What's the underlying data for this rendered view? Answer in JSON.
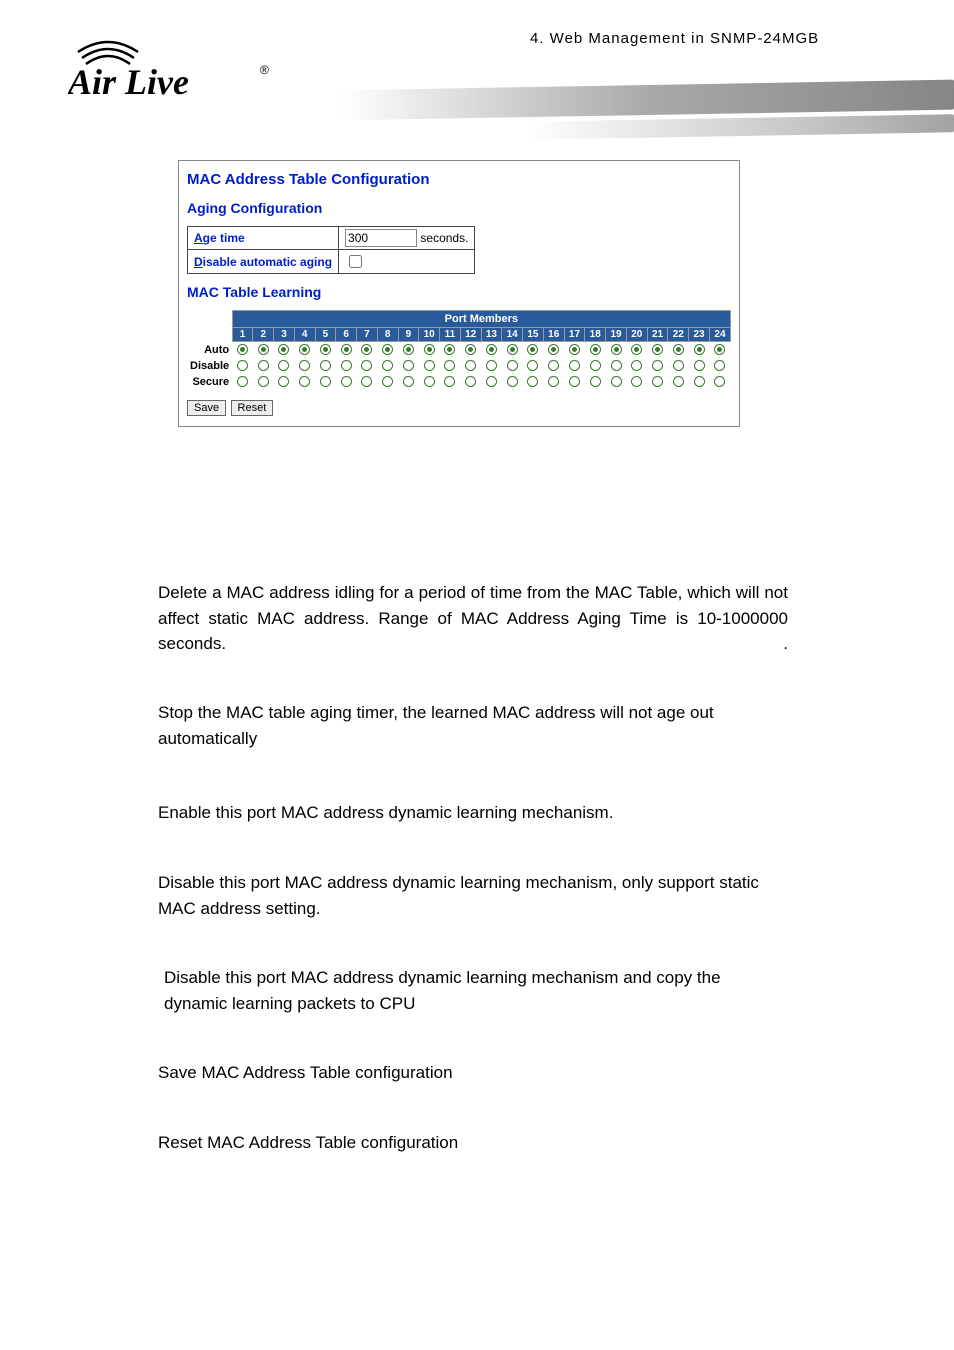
{
  "header": {
    "section": "4.  Web  Management  in  SNMP-24MGB"
  },
  "logo": {
    "brand": "Air Live",
    "mark": "®"
  },
  "panel": {
    "title": "MAC Address Table Configuration",
    "aging_title": "Aging Configuration",
    "age_time_label_u": "A",
    "age_time_label_rest": "ge time",
    "age_time_value": "300",
    "age_time_suffix": "seconds.",
    "disable_label_u": "D",
    "disable_label_rest": "isable automatic aging",
    "learning_title": "MAC Table Learning",
    "ports_header": "Port Members",
    "port_nums": [
      "1",
      "2",
      "3",
      "4",
      "5",
      "6",
      "7",
      "8",
      "9",
      "10",
      "11",
      "12",
      "13",
      "14",
      "15",
      "16",
      "17",
      "18",
      "19",
      "20",
      "21",
      "22",
      "23",
      "24"
    ],
    "rows": [
      {
        "label": "Auto",
        "selected": true
      },
      {
        "label": "Disable",
        "selected": false
      },
      {
        "label": "Secure",
        "selected": false
      }
    ],
    "save_label": "Save",
    "reset_label": "Reset"
  },
  "paragraphs": {
    "p1": "Delete a MAC address idling for a period of time from the MAC Table, which will not affect static MAC address.  Range of MAC Address Aging Time is 10-1000000 seconds.",
    "p1_tail": ".",
    "p2": "Stop the MAC table aging timer, the learned MAC address will not age out automatically",
    "p3": "Enable this port MAC address dynamic learning mechanism.",
    "p4": "Disable this port MAC address dynamic learning mechanism, only support static MAC address setting.",
    "p5": "Disable this port MAC address dynamic learning mechanism and copy the dynamic learning packets to CPU",
    "p6": "Save MAC Address Table configuration",
    "p7": "Reset MAC Address Table configuration"
  }
}
